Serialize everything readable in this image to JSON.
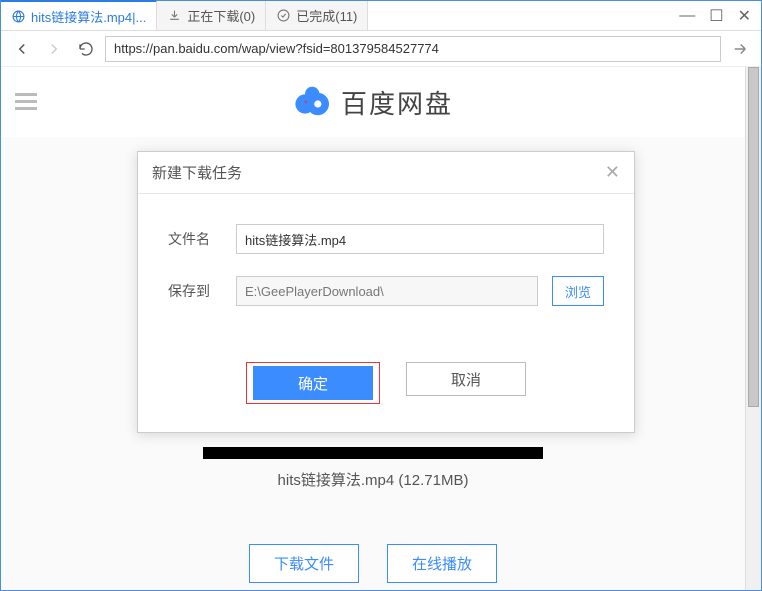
{
  "tabs": [
    {
      "label": "hits链接算法.mp4|...",
      "icon": "globe"
    },
    {
      "label": "正在下载(0)",
      "icon": "download"
    },
    {
      "label": "已完成(11)",
      "icon": "check"
    }
  ],
  "url": "https://pan.baidu.com/wap/view?fsid=801379584527774",
  "siteLogoText": "百度网盘",
  "filePreview": {
    "name": "hits链接算法.mp4",
    "size": "12.71MB"
  },
  "actions": {
    "download": "下载文件",
    "playOnline": "在线播放"
  },
  "dialog": {
    "title": "新建下载任务",
    "filenameLabel": "文件名",
    "filenameValue": "hits链接算法.mp4",
    "saveToLabel": "保存到",
    "saveToValue": "E:\\GeePlayerDownload\\",
    "browse": "浏览",
    "confirm": "确定",
    "cancel": "取消"
  }
}
